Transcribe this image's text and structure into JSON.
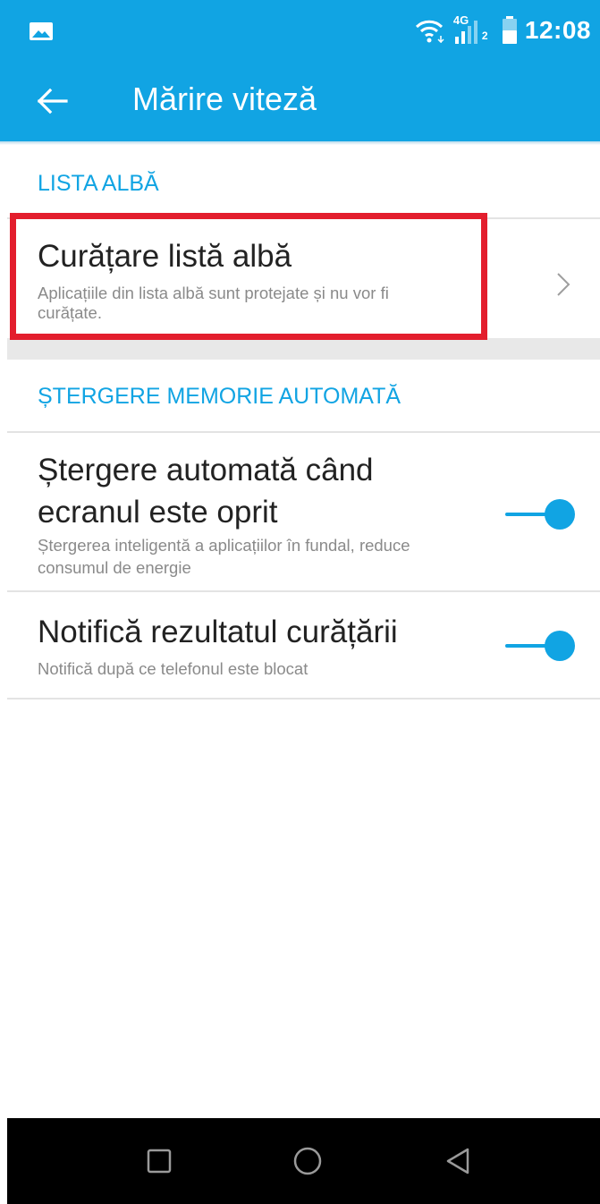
{
  "status_bar": {
    "time": "12:08",
    "network_label": "4G",
    "sim_slot": "2",
    "icons": [
      "gallery-icon",
      "wifi-icon",
      "signal-icon",
      "battery-icon"
    ]
  },
  "app_bar": {
    "title": "Mărire viteză",
    "back_icon": "arrow-left-icon"
  },
  "sections": [
    {
      "header": "LISTA ALBĂ",
      "items": [
        {
          "title": "Curățare listă albă",
          "summary_line1": "Aplicațiile din lista albă sunt protejate și nu vor fi",
          "summary_line2": "curățate.",
          "control": "chevron-right-icon"
        }
      ]
    },
    {
      "header": "ȘTERGERE MEMORIE AUTOMATĂ",
      "items": [
        {
          "title_line1": "Ștergere automată când",
          "title_line2": "ecranul este oprit",
          "summary_line1": "Ștergerea inteligentă a aplicațiilor în fundal, reduce",
          "summary_line2": "consumul de energie",
          "control": "toggle",
          "enabled": true
        },
        {
          "title": "Notifică rezultatul curățării",
          "summary": "Notifică după ce telefonul este blocat",
          "control": "toggle",
          "enabled": true
        }
      ]
    }
  ],
  "nav_bar": {
    "buttons": [
      "recents-square-icon",
      "home-circle-icon",
      "back-triangle-icon"
    ]
  },
  "colors": {
    "primary": "#11a4e3",
    "highlight": "#e31e2d",
    "title_text": "#222222",
    "summary_text": "#8a8a8a"
  }
}
